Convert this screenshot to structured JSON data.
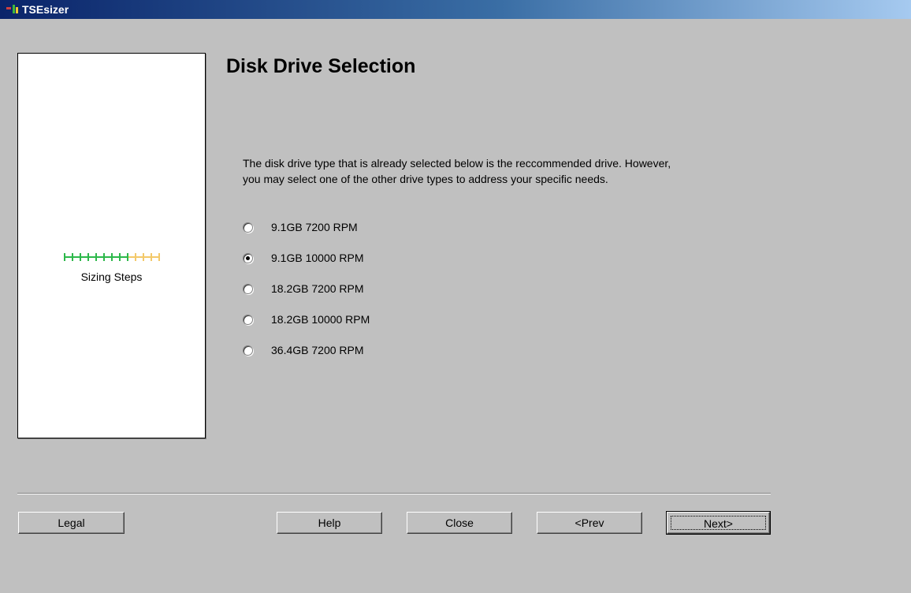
{
  "window": {
    "title": "TSEsizer"
  },
  "sidebar": {
    "steps_label": "Sizing Steps",
    "steps_total": 13,
    "steps_completed": 9
  },
  "main": {
    "title": "Disk Drive Selection",
    "description_line1": "The disk drive type that is already selected below is the reccommended drive.  However,",
    "description_line2": "you may select one of the other drive types to address your specific needs.",
    "options": [
      {
        "label": "9.1GB 7200 RPM",
        "selected": false
      },
      {
        "label": "9.1GB 10000 RPM",
        "selected": true
      },
      {
        "label": "18.2GB 7200 RPM",
        "selected": false
      },
      {
        "label": "18.2GB 10000 RPM",
        "selected": false
      },
      {
        "label": "36.4GB 7200 RPM",
        "selected": false
      }
    ]
  },
  "buttons": {
    "legal": "Legal",
    "help": "Help",
    "close": "Close",
    "prev": "<Prev",
    "next": "Next>"
  },
  "colors": {
    "step_done": "#2db84b",
    "step_todo": "#f3c96a"
  }
}
